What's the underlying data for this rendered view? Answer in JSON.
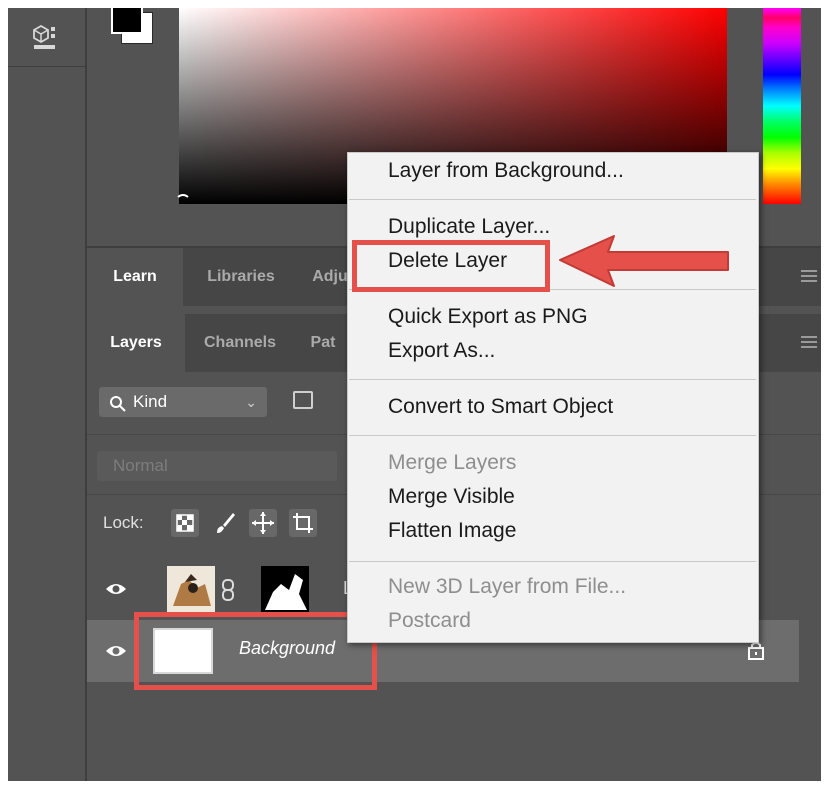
{
  "colors": {
    "accent_highlight": "#e5504a",
    "panel_bg": "#535353",
    "menu_bg": "#f2f2f2"
  },
  "toolbar": {
    "tool_icon": "3d-cube-icon"
  },
  "panels": {
    "top_tabs": [
      {
        "label": "Learn",
        "active": true
      },
      {
        "label": "Libraries",
        "active": false
      },
      {
        "label": "Adju",
        "active": false
      }
    ],
    "layer_tabs": [
      {
        "label": "Layers",
        "active": true
      },
      {
        "label": "Channels",
        "active": false
      },
      {
        "label": "Pat",
        "active": false
      }
    ]
  },
  "layers_panel": {
    "filter": {
      "kind_label": "Kind",
      "search_icon": "search-icon",
      "chevron_icon": "chevron-down-icon"
    },
    "blend_mode": "Normal",
    "lock_label": "Lock:",
    "layers": [
      {
        "name": "La",
        "visible": true,
        "selected": false,
        "has_mask": true
      },
      {
        "name": "Background",
        "visible": true,
        "selected": true,
        "locked": true
      }
    ]
  },
  "context_menu": {
    "items": [
      {
        "label": "Layer from Background...",
        "disabled": false
      },
      {
        "label": "Duplicate Layer...",
        "disabled": false
      },
      {
        "label": "Delete Layer",
        "disabled": false,
        "highlighted": true
      },
      {
        "label": "Quick Export as PNG",
        "disabled": false
      },
      {
        "label": "Export As...",
        "disabled": false
      },
      {
        "label": "Convert to Smart Object",
        "disabled": false
      },
      {
        "label": "Merge Layers",
        "disabled": true
      },
      {
        "label": "Merge Visible",
        "disabled": false
      },
      {
        "label": "Flatten Image",
        "disabled": false
      },
      {
        "label": "New 3D Layer from File...",
        "disabled": true
      },
      {
        "label": "Postcard",
        "disabled": true
      }
    ]
  }
}
